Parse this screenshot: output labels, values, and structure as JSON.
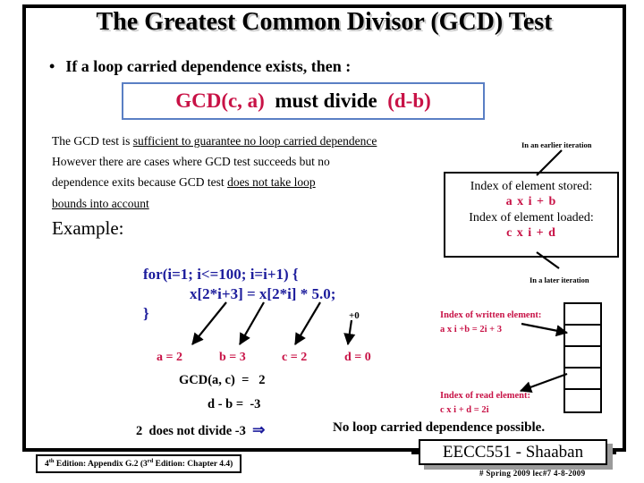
{
  "slide": {
    "title": "The Greatest Common Divisor (GCD) Test",
    "bullet": {
      "marker": "•",
      "text": "If a loop carried dependence exists, then :"
    },
    "gcd_statement": {
      "part1": "GCD(c, a)",
      "part2": "  must divide  ",
      "part3": "(d-b)",
      "border_color": "#5a7fc4",
      "red_color": "#c81246"
    },
    "paragraph": {
      "line1_plain": "The GCD test is ",
      "line1_underlined": "sufficient to guarantee no loop carried dependence",
      "line2": "However there are cases where GCD test succeeds but no",
      "line3_plain": "dependence exits because GCD test ",
      "line3_underlined": "does not take loop",
      "line4_underlined": "bounds into account"
    },
    "example_label": "Example:",
    "code": {
      "line1": "for(i=1; i<=100; i=i+1) {",
      "line2": "x[2*i+3] = x[2*i] * 5.0;",
      "line3": "}",
      "color": "#1c1c9c"
    },
    "plus_zero_label": "+0",
    "values": {
      "a": "a = 2",
      "b": "b = 3",
      "c": "c = 2",
      "d": "d = 0"
    },
    "equations": {
      "gcd_line": "GCD(a, c)  =   2",
      "diff_line": "d - b =  -3",
      "divide_line": "2  does not divide -3",
      "implies_glyph": "⇒",
      "conclusion": "No loop carried dependence possible."
    },
    "right_panel": {
      "caption_earlier": "In an earlier iteration",
      "caption_later": "In a later iteration",
      "index_box": {
        "stored_label": "Index of element stored:",
        "stored_expr": "a x i + b",
        "loaded_label": "Index of element loaded:",
        "loaded_expr": "c x i + d"
      },
      "written_label": "Index of written element:",
      "written_expr": "a  x  i  +b   = 2i + 3",
      "read_label": "Index of read element:",
      "read_expr": "c  x  i  + d = 2i",
      "memory_cells": [
        "",
        "",
        "",
        "",
        ""
      ]
    },
    "footer": {
      "edition_pre": "4",
      "edition_sup1": "th",
      "edition_mid": " Edition: Appendix G.2 (3",
      "edition_sup2": "rd",
      "edition_post": " Edition: Chapter 4.4)",
      "plaque": "EECC551 - Shaaban",
      "date_line": "#  Spring 2009  lec#7   4-8-2009"
    }
  }
}
